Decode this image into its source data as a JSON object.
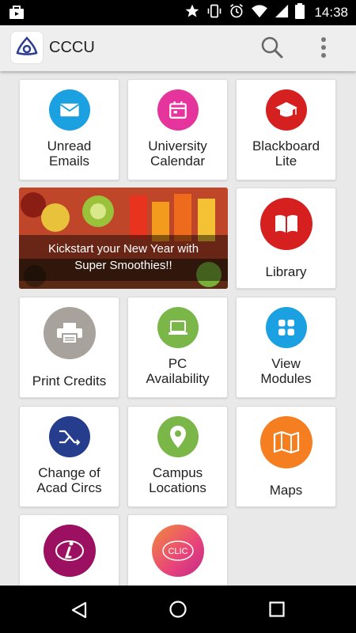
{
  "status_bar": {
    "time": "14:38"
  },
  "app_bar": {
    "title": "CCCU"
  },
  "tiles": {
    "unread_emails": {
      "label": "Unread\nEmails",
      "color": "#1ba0e2"
    },
    "university_calendar": {
      "label": "University\nCalendar",
      "color": "#e5359c"
    },
    "blackboard_lite": {
      "label": "Blackboard\nLite",
      "color": "#d61f1f"
    },
    "library": {
      "label": "Library",
      "color": "#d61f1f"
    },
    "print_credits": {
      "label": "Print Credits",
      "color": "#a8a29c"
    },
    "pc_availability": {
      "label": "PC\nAvailability",
      "color": "#7ab648"
    },
    "view_modules": {
      "label": "View\nModules",
      "color": "#1ba0e2"
    },
    "change_of_acad_circs": {
      "label": "Change of\nAcad Circs",
      "color": "#263c8c"
    },
    "campus_locations": {
      "label": "Campus\nLocations",
      "color": "#7ab648"
    },
    "maps": {
      "label": "Maps",
      "color": "#f57f20"
    },
    "info": {
      "color": "#9c1062"
    },
    "clic": {
      "icon_text": "CLIC",
      "color": "#ee5f6f"
    }
  },
  "banner": {
    "caption": "Kickstart your New Year with\nSuper Smoothies!!"
  }
}
